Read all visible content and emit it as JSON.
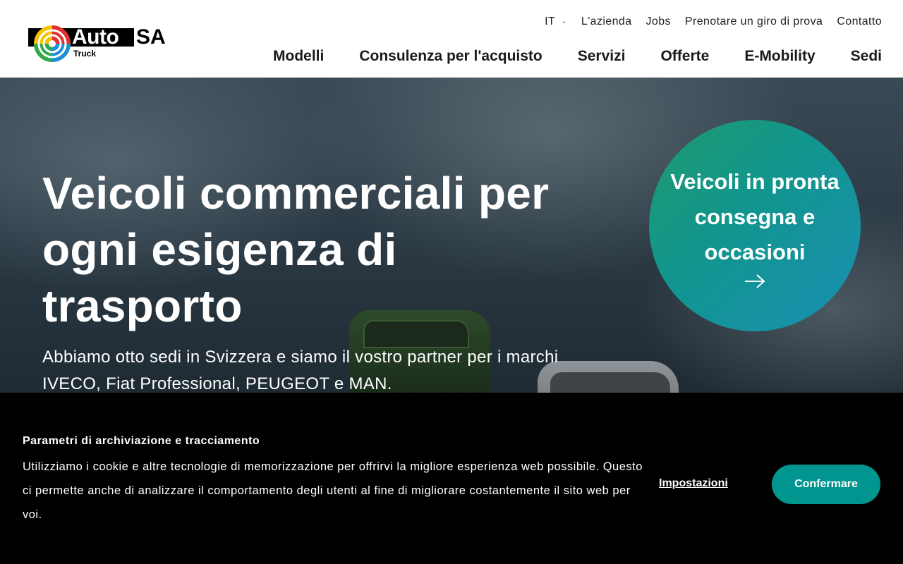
{
  "brand": {
    "logo_word": "Auto",
    "logo_suffix": "SA",
    "logo_sub": "Truck"
  },
  "topnav": {
    "language": "IT",
    "items": [
      "L'azienda",
      "Jobs",
      "Prenotare un giro di prova",
      "Contatto"
    ]
  },
  "mainnav": {
    "items": [
      "Modelli",
      "Consulenza per l'acquisto",
      "Servizi",
      "Offerte",
      "E-Mobility",
      "Sedi"
    ]
  },
  "hero": {
    "title": "Veicoli commerciali per ogni esigenza di trasporto",
    "subtitle": "Abbiamo otto sedi in Svizzera e siamo il vostro partner per i marchi IVECO, Fiat Professional, PEUGEOT e MAN.",
    "cta": "Veicoli in pronta consegna e occasioni",
    "cta_icon": "arrow-right-icon"
  },
  "cookie": {
    "title": "Parametri di archiviazione e tracciamento",
    "text": "Utilizziamo i cookie e altre tecnologie di memorizzazione per offrirvi la migliore esperienza web possibile. Questo ci permette anche di analizzare il comportamento degli utenti al fine di migliorare costantemente il sito web per voi.",
    "settings_label": "Impostazioni",
    "confirm_label": "Confermare"
  },
  "colors": {
    "accent": "#00958f",
    "cta_gradient_start": "#1f9a6e",
    "cta_gradient_end": "#1a8fb3",
    "cookie_bg": "#000000"
  }
}
